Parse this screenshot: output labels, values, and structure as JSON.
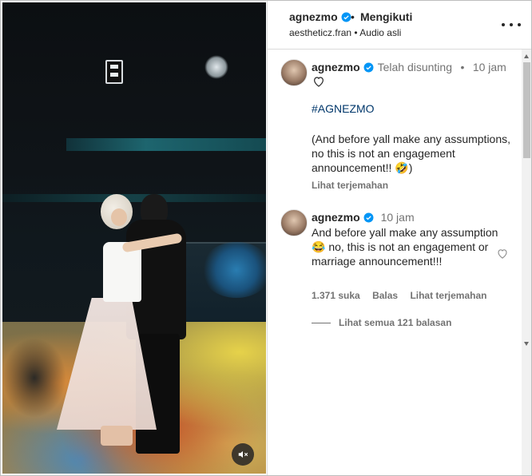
{
  "header": {
    "username": "agnezmo",
    "dot": "•",
    "follow_status": "Mengikuti",
    "audio_user": "aestheticz.fran",
    "audio_dot": "•",
    "audio_label": "Audio asli"
  },
  "caption": {
    "username": "agnezmo",
    "edited": "Telah disunting",
    "dot": "•",
    "time": "10 jam",
    "hashtag": "#AGNEZMO",
    "text": "(And before yall make any assumptions, no this is not an engagement announcement!! 🤣)",
    "translate": "Lihat terjemahan"
  },
  "comment": {
    "username": "agnezmo",
    "time": "10 jam",
    "text": "And before yall make any assumption 😂 no, this is not an engagement or marriage announcement!!!",
    "likes": "1.371 suka",
    "reply": "Balas",
    "translate": "Lihat terjemahan",
    "view_replies": "Lihat semua 121 balasan"
  },
  "icons": {
    "verified": "verified-badge-icon",
    "heart": "heart-outline-icon",
    "more": "more-options-icon",
    "mute": "speaker-muted-icon"
  },
  "colors": {
    "verified": "#0095f6",
    "link": "#00376b",
    "muted_text": "#737373"
  }
}
